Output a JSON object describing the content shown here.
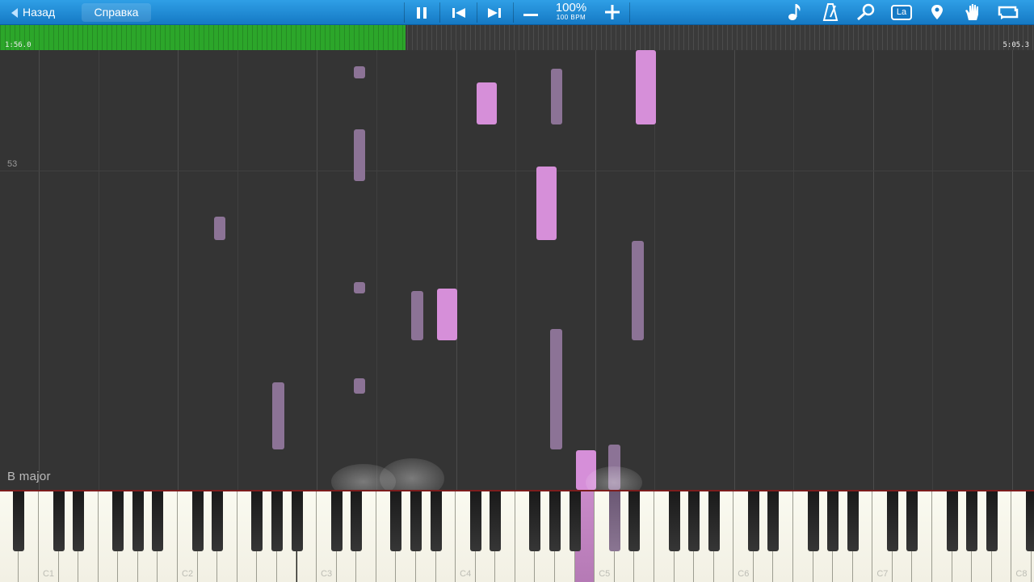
{
  "toolbar": {
    "back_label": "Назад",
    "help_label": "Справка",
    "tempo_percent": "100%",
    "tempo_bpm": "100 BPM",
    "la_label": "La",
    "icons": {
      "pause": "pause-icon",
      "prev": "skip-back-icon",
      "next": "skip-forward-icon",
      "minus": "minus-icon",
      "plus": "plus-icon",
      "note": "music-note-icon",
      "metronome": "metronome-icon",
      "magnifier": "magnifier-icon",
      "pin": "location-pin-icon",
      "hand": "hand-icon",
      "loop": "loop-icon"
    }
  },
  "progress": {
    "current_time": "1:56.0",
    "total_time": "5:05.3",
    "fraction_played": 0.392,
    "played_color": "#2ca62a"
  },
  "roll": {
    "measure_number": "53",
    "key_signature": "B major",
    "left_hand_color": "#8c7396",
    "right_hand_color": "#d68fd9"
  },
  "keyboard": {
    "octave_labels": [
      "C1",
      "C2",
      "C3",
      "C4",
      "C5",
      "C6",
      "C7",
      "C8"
    ]
  }
}
